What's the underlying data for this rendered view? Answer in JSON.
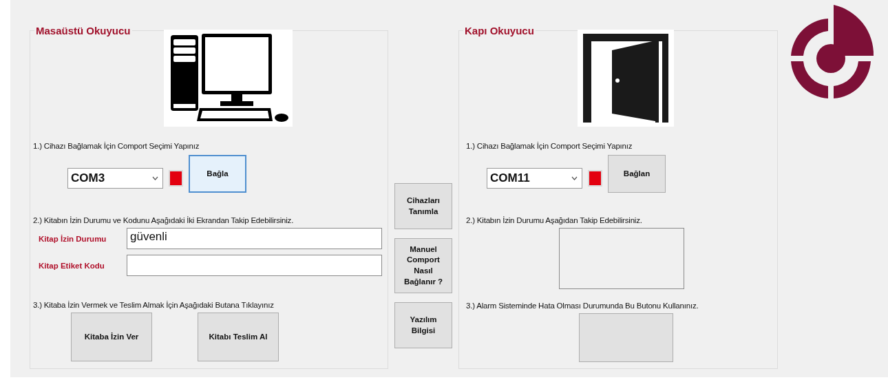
{
  "desktop_reader": {
    "title": "Masaüstü Okuyucu",
    "step1": "1.) Cihazı Bağlamak İçin Comport Seçimi Yapınız",
    "port": "COM3",
    "connected": false,
    "connect_button": {
      "label": "Bağla",
      "focused": true
    },
    "step2": "2.) Kitabın İzin Durumu ve Kodunu Aşağıdaki İki Ekrandan Takip Edebilirsiniz.",
    "fields": [
      {
        "label": "Kitap İzin Durumu",
        "value": "güvenli"
      },
      {
        "label": "Kitap Etiket Kodu"
      }
    ],
    "step3": "3.) Kitaba İzin Vermek ve Teslim Almak İçin Aşağıdaki Butana Tıklayınız",
    "buttons": [
      "Kitaba İzin Ver",
      "Kitabı Teslim Al"
    ]
  },
  "side_buttons": [
    "Cihazları\nTanımla",
    "Manuel\nComport\nNasıl\nBağlanır ?",
    "Yazılım\nBilgisi"
  ],
  "door_reader": {
    "title": "Kapı Okuyucu",
    "step1": "1.) Cihazı Bağlamak İçin Comport Seçimi Yapınız",
    "port": "COM11",
    "connected": false,
    "connect_button": {
      "label": "Bağlan",
      "focused": false
    },
    "step2": "2.) Kitabın İzin Durumu Aşağıdan Takip Edebilirsiniz.",
    "step3": "3.) Alarm Sisteminde Hata Olması Durumunda Bu Butonu Kullanınız."
  }
}
